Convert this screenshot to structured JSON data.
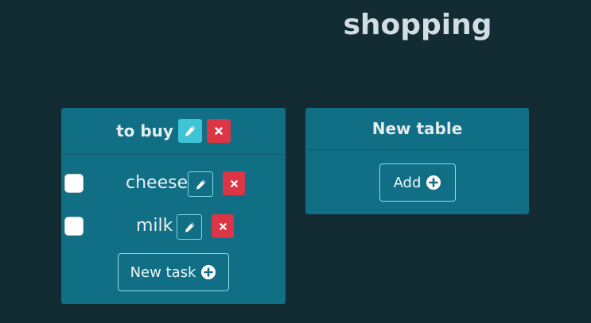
{
  "page": {
    "title": "shopping"
  },
  "tables": [
    {
      "title": "to buy",
      "tasks": [
        {
          "label": "cheese",
          "checked": false
        },
        {
          "label": "milk",
          "checked": false
        }
      ],
      "new_task_label": "New task"
    },
    {
      "title": "New table",
      "add_label": "Add"
    }
  ],
  "icons": {
    "edit": "pencil-icon",
    "delete": "close-icon",
    "add": "plus-circle-icon"
  },
  "colors": {
    "background": "#132b33",
    "card": "#116f85",
    "edit_button": "#3fc3d6",
    "delete_button": "#dc3545"
  }
}
